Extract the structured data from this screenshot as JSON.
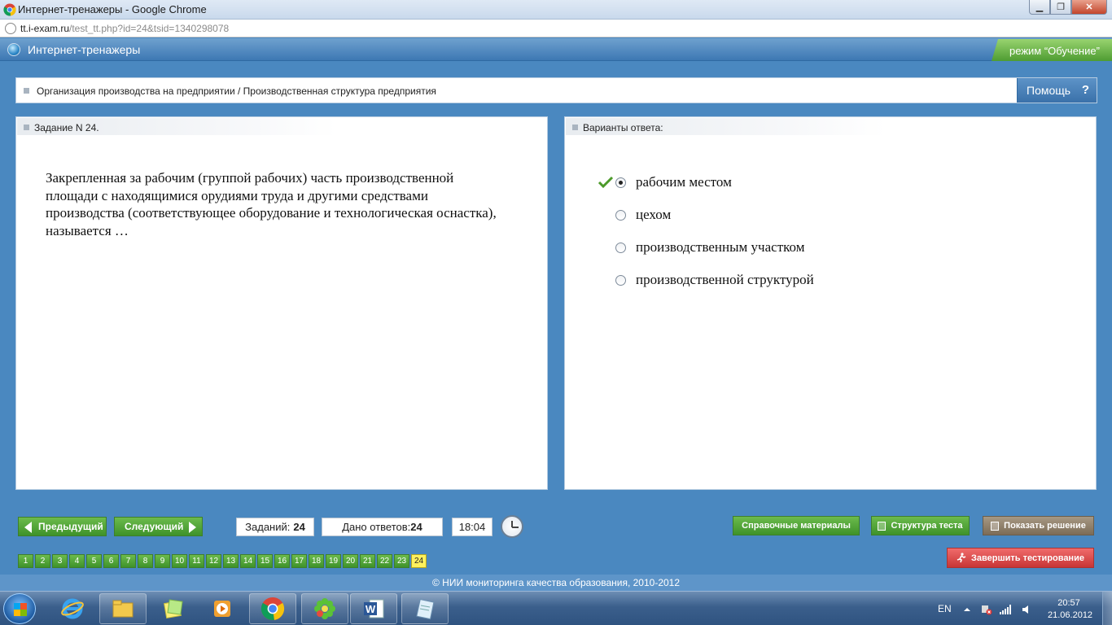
{
  "window": {
    "title": "Интернет-тренажеры - Google Chrome",
    "url_host": "tt.i-exam.ru",
    "url_rest": "/test_tt.php?id=24&tsid=1340298078"
  },
  "app": {
    "title": "Интернет-тренажеры",
    "mode": "режим “Обучение”"
  },
  "breadcrumb": {
    "text": "Организация производства на предприятии / Производственная структура предприятия",
    "help_label": "Помощь",
    "help_icon": "?"
  },
  "task": {
    "header": "Задание N 24.",
    "question": "Закрепленная за рабочим (группой рабочих) часть производственной площади с находящимися орудиями труда и другими средствами производства (соответствующее оборудование и технологическая оснастка), называется …"
  },
  "answers": {
    "header": "Варианты ответа:",
    "options": [
      {
        "label": "рабочим местом",
        "selected": true,
        "correct": true
      },
      {
        "label": "цехом",
        "selected": false,
        "correct": false
      },
      {
        "label": "производственным участком",
        "selected": false,
        "correct": false
      },
      {
        "label": "производственной структурой",
        "selected": false,
        "correct": false
      }
    ]
  },
  "nav": {
    "prev_label": "Предыдущий",
    "next_label": "Следующий",
    "tasks_label": "Заданий:",
    "tasks_value": "24",
    "given_label": "Дано ответов:",
    "given_value": "24",
    "time": "18:04"
  },
  "actions": {
    "reference_label": "Справочные материалы",
    "structure_label": "Структура теста",
    "solution_label": "Показать решение",
    "finish_label": "Завершить тестирование"
  },
  "pager": {
    "pages": [
      "1",
      "2",
      "3",
      "4",
      "5",
      "6",
      "7",
      "8",
      "9",
      "10",
      "11",
      "12",
      "13",
      "14",
      "15",
      "16",
      "17",
      "18",
      "19",
      "20",
      "21",
      "22",
      "23",
      "24"
    ],
    "current": "24"
  },
  "footer": {
    "text": "© НИИ мониторинга качества образования, 2010-2012"
  },
  "taskbar": {
    "lang": "EN",
    "time": "20:57",
    "date": "21.06.2012",
    "apps": [
      "internet-explorer",
      "file-explorer",
      "sticky-notes",
      "media-player",
      "chrome",
      "icq",
      "word",
      "notepad"
    ]
  },
  "colors": {
    "accent_blue": "#4a88c0",
    "green_button": "#4e9c32",
    "current_page": "#fff15d",
    "finish_red": "#c83535"
  }
}
